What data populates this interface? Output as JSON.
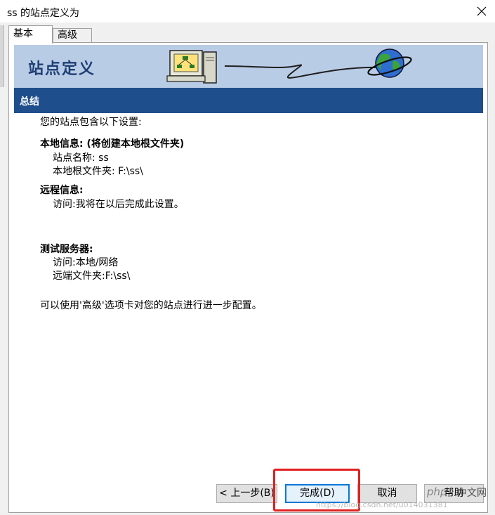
{
  "window": {
    "title": "ss 的站点定义为",
    "close_icon": "close-icon"
  },
  "tabs": [
    {
      "label": "基本",
      "active": true
    },
    {
      "label": "高级",
      "active": false
    }
  ],
  "banner": {
    "title": "站点定义",
    "icons": [
      "computer-network-icon",
      "globe-icon"
    ]
  },
  "section": {
    "title": "总结"
  },
  "summary": {
    "intro": "您的站点包含以下设置:",
    "local_info": {
      "heading": "本地信息: (将创建本地根文件夹)",
      "site_name": "站点名称: ss",
      "local_root": "本地根文件夹: F:\\ss\\"
    },
    "remote_info": {
      "heading": "远程信息:",
      "access": "访问:我将在以后完成此设置。"
    },
    "test_server": {
      "heading": "测试服务器:",
      "access": "访问:本地/网络",
      "remote_folder": "远端文件夹:F:\\ss\\"
    },
    "footer_note": "可以使用'高级'选项卡对您的站点进行进一步配置。"
  },
  "buttons": {
    "back": "< 上一步(B)",
    "finish": "完成(D)",
    "cancel": "取消",
    "help": "帮助"
  },
  "watermarks": {
    "php": "php",
    "cn": "中文网",
    "url": "https://blog.csdn.net/u014031381"
  },
  "colors": {
    "banner_bg": "#b9cce6",
    "section_bg": "#1f4e8c",
    "highlight": "#e02020"
  }
}
